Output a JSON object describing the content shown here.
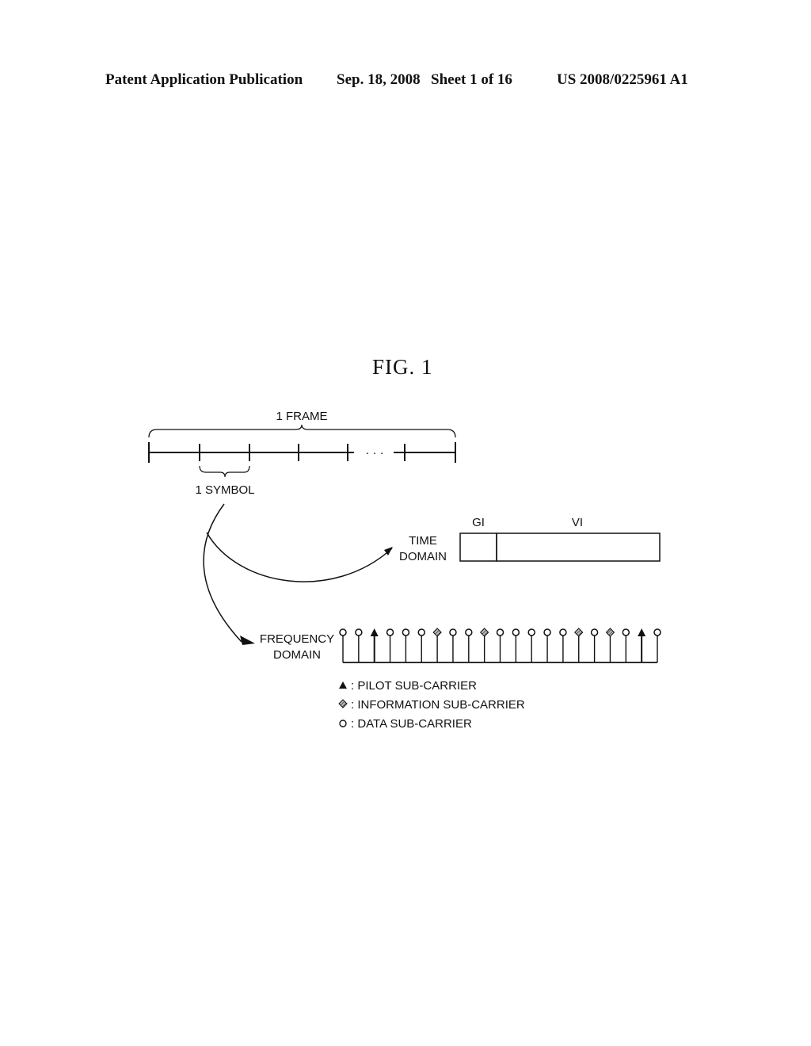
{
  "header": {
    "publication": "Patent Application Publication",
    "date": "Sep. 18, 2008",
    "sheet": "Sheet 1 of 16",
    "number": "US 2008/0225961 A1"
  },
  "figure": {
    "title": "FIG. 1",
    "frame_label": "1 FRAME",
    "symbol_label": "1 SYMBOL",
    "ellipsis": "· · ·",
    "time_domain": {
      "label_line1": "TIME",
      "label_line2": "DOMAIN",
      "segments": [
        "GI",
        "VI"
      ]
    },
    "frequency_domain": {
      "label_line1": "FREQUENCY",
      "label_line2": "DOMAIN",
      "subcarriers": [
        "data",
        "data",
        "pilot",
        "data",
        "data",
        "data",
        "information",
        "data",
        "data",
        "information",
        "data",
        "data",
        "data",
        "data",
        "data",
        "information",
        "data",
        "information",
        "data",
        "pilot",
        "data"
      ]
    },
    "legend": [
      {
        "type": "pilot",
        "symbol": "▲",
        "label": ": PILOT SUB-CARRIER"
      },
      {
        "type": "information",
        "symbol": "◆",
        "label": ": INFORMATION SUB-CARRIER"
      },
      {
        "type": "data",
        "symbol": "o",
        "label": ": DATA SUB-CARRIER"
      }
    ]
  }
}
